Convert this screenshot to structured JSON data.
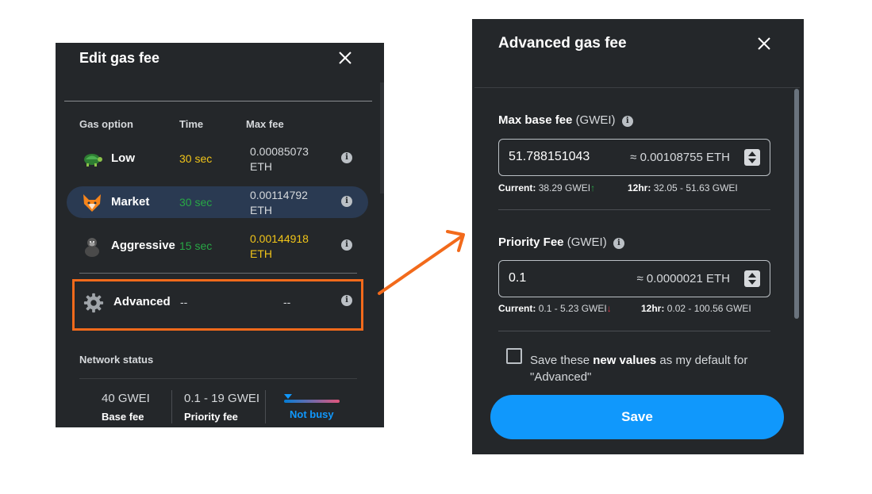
{
  "edit_gas_fee": {
    "title": "Edit gas fee",
    "columns": {
      "option": "Gas option",
      "time": "Time",
      "max_fee": "Max fee"
    },
    "options": [
      {
        "icon": "turtle-icon",
        "name": "Low",
        "time": "30 sec",
        "fee_line1": "0.00085073",
        "fee_line2": "ETH"
      },
      {
        "icon": "fox-icon",
        "name": "Market",
        "time": "30 sec",
        "fee_line1": "0.00114792",
        "fee_line2": "ETH"
      },
      {
        "icon": "gorilla-icon",
        "name": "Aggressive",
        "time": "15 sec",
        "fee_line1": "0.00144918",
        "fee_line2": "ETH"
      }
    ],
    "advanced": {
      "icon": "gear-icon",
      "name": "Advanced",
      "time": "--",
      "fee": "--"
    },
    "network_status": {
      "title": "Network status",
      "base_fee_value": "40 GWEI",
      "base_fee_label": "Base fee",
      "priority_fee_value": "0.1 - 19 GWEI",
      "priority_fee_label": "Priority fee",
      "status": "Not busy"
    }
  },
  "advanced_gas_fee": {
    "title": "Advanced gas fee",
    "max_base_fee": {
      "label": "Max base fee",
      "unit": "(GWEI)",
      "value": "51.788151043",
      "eth_estimate": "≈ 0.00108755 ETH",
      "current_label": "Current:",
      "current_value": "38.29 GWEI",
      "trend": "↑",
      "range_label": "12hr:",
      "range_value": "32.05 - 51.63 GWEI"
    },
    "priority_fee": {
      "label": "Priority Fee",
      "unit": "(GWEI)",
      "value": "0.1",
      "eth_estimate": "≈ 0.0000021 ETH",
      "current_label": "Current:",
      "current_value": "0.1 - 5.23 GWEI",
      "trend": "↓",
      "range_label": "12hr:",
      "range_value": "0.02 - 100.56 GWEI"
    },
    "save_default": {
      "text_before": "Save these ",
      "text_bold": "new values",
      "text_after": " as my default for",
      "text_line2": "\"Advanced\""
    },
    "save_button": "Save"
  },
  "colors": {
    "panel_bg": "#24272a",
    "selected_row": "#2a3a52",
    "accent_blue": "#1098fc",
    "highlight_orange": "#f26a1b",
    "time_yellow": "#f0c419",
    "time_green": "#28a745"
  }
}
